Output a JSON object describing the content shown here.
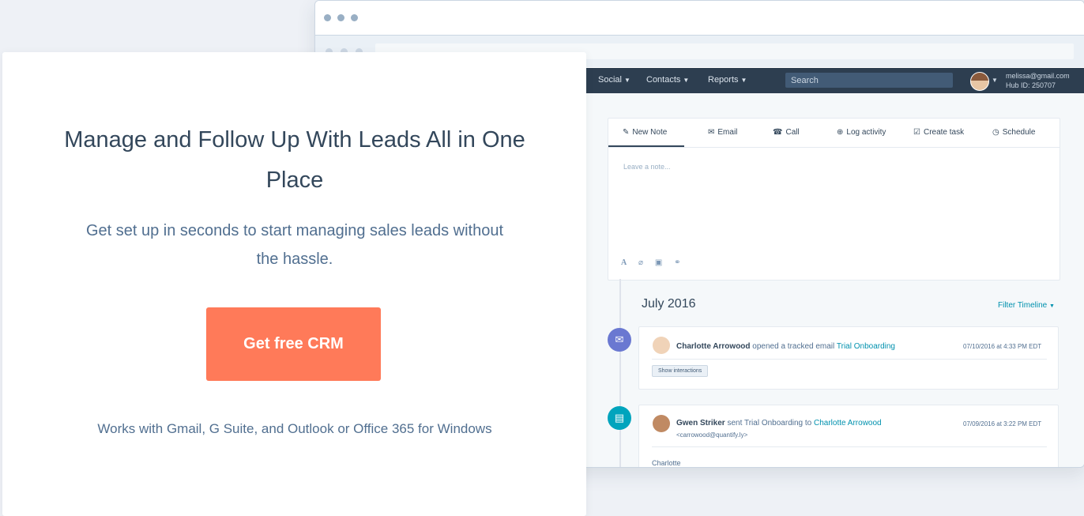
{
  "hero": {
    "headline": "Manage and Follow Up With Leads All in One Place",
    "subheadline": "Get set up in seconds to start managing sales leads without the hassle.",
    "cta_label": "Get free CRM",
    "works_with": "Works with Gmail, G Suite, and Outlook or Office 365 for Windows"
  },
  "app": {
    "nav": {
      "items": [
        {
          "label": "Social"
        },
        {
          "label": "Contacts"
        },
        {
          "label": "Reports"
        }
      ],
      "search_placeholder": "Search",
      "account_email": "melissa@gmail.com",
      "hub_id": "Hub ID: 250707"
    },
    "composer": {
      "tabs": [
        {
          "label": "New Note",
          "icon": "pencil-icon"
        },
        {
          "label": "Email",
          "icon": "envelope-icon"
        },
        {
          "label": "Call",
          "icon": "phone-icon"
        },
        {
          "label": "Log activity",
          "icon": "plus-circle-icon"
        },
        {
          "label": "Create task",
          "icon": "checkbox-icon"
        },
        {
          "label": "Schedule",
          "icon": "clock-icon"
        }
      ],
      "placeholder": "Leave a note...",
      "format_tools": [
        "text-format-icon",
        "attach-icon",
        "image-icon",
        "link-icon"
      ]
    },
    "timeline": {
      "month": "July 2016",
      "filter_label": "Filter Timeline",
      "events": [
        {
          "actor": "Charlotte Arrowood",
          "action": "opened a tracked email",
          "target": "Trial Onboarding",
          "date": "07/10/2016 at 4:33 PM EDT",
          "button": "Show interactions",
          "icon": "envelope-icon"
        },
        {
          "actor": "Gwen Striker",
          "action": "sent Trial Onboarding to",
          "target": "Charlotte Arrowood",
          "email": "<carrowood@quantify.ly>",
          "date": "07/09/2016 at 3:22 PM EDT",
          "body_start": "Charlotte",
          "icon": "document-icon"
        }
      ]
    }
  },
  "colors": {
    "accent": "#ff7a59",
    "nav_bg": "#2d3e50",
    "link": "#0091ae",
    "text": "#33475b",
    "email_icon_bg": "#6a78d1",
    "document_icon_bg": "#00a4bd"
  }
}
